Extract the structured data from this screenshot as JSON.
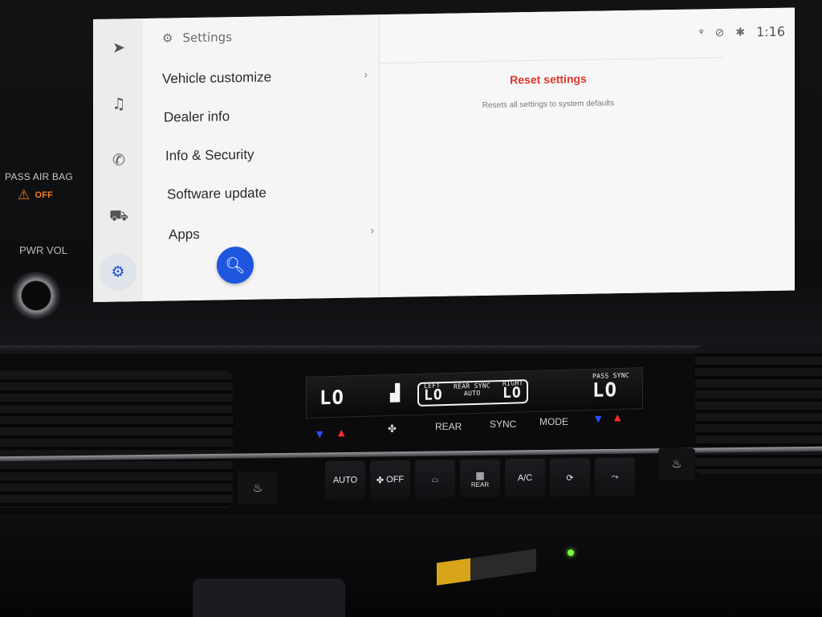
{
  "dashboard": {
    "airbag_label": "PASS AIR BAG",
    "airbag_status": "OFF",
    "volume_label": "PWR VOL"
  },
  "screen": {
    "header": {
      "title": "Settings",
      "icon": "gear-icon"
    },
    "status_bar": {
      "icons": [
        "mic-muted-icon",
        "signal-off-icon",
        "bluetooth-icon"
      ],
      "clock": "1:16"
    },
    "rail": [
      {
        "name": "navigation",
        "icon": "navigation-arrow-icon",
        "glyph": "➤"
      },
      {
        "name": "music",
        "icon": "music-note-icon",
        "glyph": "♫"
      },
      {
        "name": "phone",
        "icon": "phone-icon",
        "glyph": "✆"
      },
      {
        "name": "vehicle",
        "icon": "car-icon",
        "glyph": "⛟"
      },
      {
        "name": "settings",
        "icon": "gear-icon",
        "glyph": "⚙",
        "active": true
      }
    ],
    "menu": [
      {
        "label": "Vehicle customize",
        "has_chevron": true
      },
      {
        "label": "Dealer info",
        "has_chevron": false
      },
      {
        "label": "Info & Security",
        "has_chevron": false
      },
      {
        "label": "Software update",
        "has_chevron": false
      },
      {
        "label": "Apps",
        "has_chevron": true
      }
    ],
    "content": {
      "title": "Reset settings",
      "description": "Resets all settings to system defaults"
    },
    "colors": {
      "accent": "#1f56e0",
      "reset_title": "#e0352b"
    }
  },
  "climate": {
    "lcd": {
      "left_temp": "LO",
      "left_label": "LEFT",
      "center_temp": "LO",
      "rear_sync_label": "REAR SYNC",
      "auto_label": "AUTO",
      "right_label": "RIGHT",
      "right_temp": "LO",
      "pass_sync_label": "PASS SYNC",
      "pass_temp": "LO"
    },
    "labels": {
      "rear": "REAR",
      "sync": "SYNC",
      "mode": "MODE"
    },
    "buttons": {
      "auto": "AUTO",
      "fan_off": "OFF",
      "rear_defrost": "REAR",
      "ac": "A/C"
    }
  }
}
